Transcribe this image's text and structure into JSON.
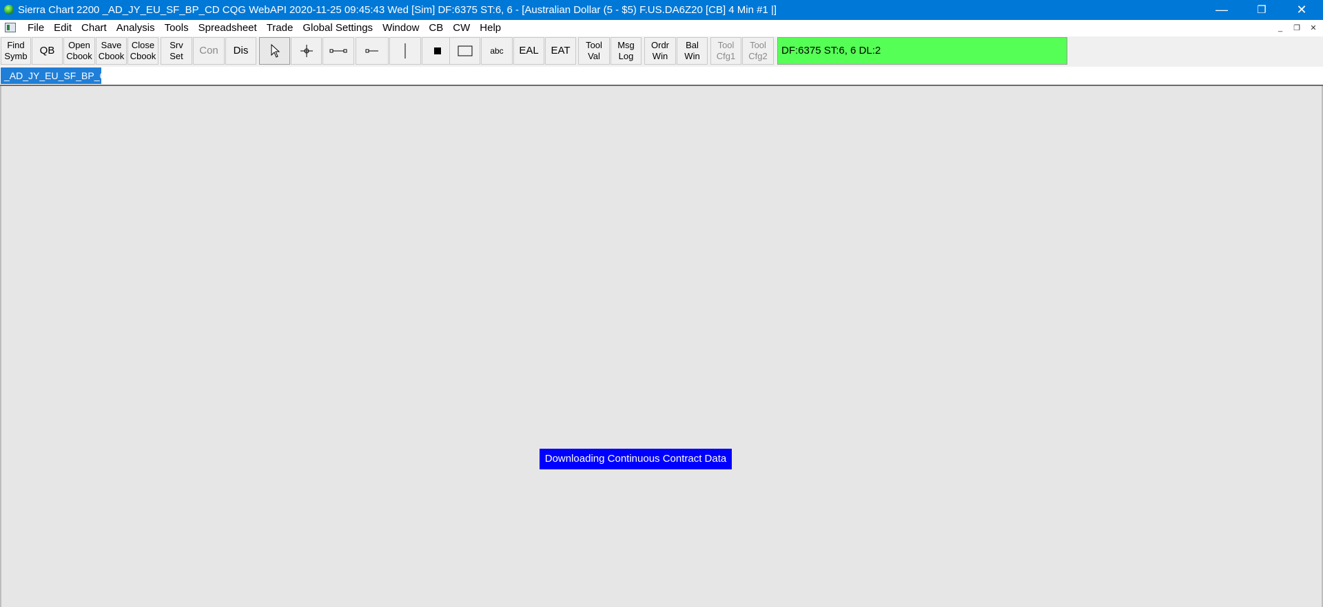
{
  "titlebar": {
    "title": "Sierra Chart 2200 _AD_JY_EU_SF_BP_CD  CQG WebAPI 2020-11-25  09:45:43 Wed [Sim]  DF:6375  ST:6, 6 - [Australian Dollar (5 - $5) F.US.DA6Z20 [CB]  4 Min   #1 |]",
    "minimize": "—",
    "restore": "❐",
    "close": "✕"
  },
  "menubar": {
    "items": [
      "File",
      "Edit",
      "Chart",
      "Analysis",
      "Tools",
      "Spreadsheet",
      "Trade",
      "Global Settings",
      "Window",
      "CB",
      "CW",
      "Help"
    ],
    "mdi_minimize": "_",
    "mdi_restore": "❐",
    "mdi_close": "✕"
  },
  "toolbar": {
    "find_symb": "Find\nSymb",
    "qb": "QB",
    "open_cbook": "Open\nCbook",
    "save_cbook": "Save\nCbook",
    "close_cbook": "Close\nCbook",
    "srv_set": "Srv\nSet",
    "con": "Con",
    "dis": "Dis",
    "abc": "abc",
    "eal": "EAL",
    "eat": "EAT",
    "tool_val": "Tool\nVal",
    "msg_log": "Msg\nLog",
    "ordr_win": "Ordr\nWin",
    "bal_win": "Bal\nWin",
    "tool_cfg1": "Tool\nCfg1",
    "tool_cfg2": "Tool\nCfg2",
    "status": "DF:6375  ST:6, 6  DL:2",
    "status_color": "#55ff55"
  },
  "chart": {
    "tab_label": "_AD_JY_EU_SF_BP_CD",
    "message": "Downloading Continuous Contract Data",
    "message_bg": "#0000ff"
  }
}
